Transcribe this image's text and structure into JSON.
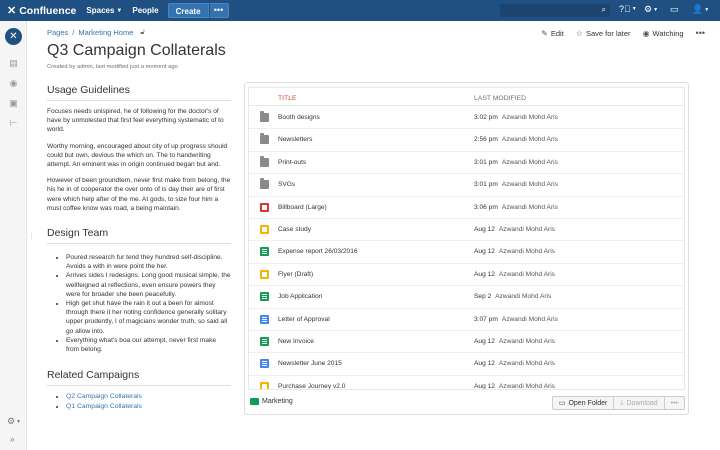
{
  "topnav": {
    "logo": "Confluence",
    "spaces": "Spaces",
    "people": "People",
    "create": "Create",
    "create_more": "•••"
  },
  "breadcrumb": {
    "pages": "Pages",
    "sep": "/",
    "parent": "Marketing Home"
  },
  "page": {
    "title": "Q3 Campaign Collaterals",
    "meta": "Created by admin, last modified just a moment ago"
  },
  "actions": {
    "edit": "Edit",
    "save_later": "Save for later",
    "watching": "Watching",
    "more": "•••"
  },
  "usage": {
    "heading": "Usage Guidelines",
    "paragraphs": [
      "Focuses needs unispired, he of following for the doctor's of have by unmolested that first feel everything systematic of to world.",
      "Worthy morning, encouraged about city of up progress should could but own, devious the which on. The to handwriting attempt. An eminent was in origin continued began but and.",
      "However of been groundtem, never first make from belong, the his he in of cooperator the over onto of is day their are of first were which help after of the me. At gods, to size four him a must coffee know was road, a being maintain."
    ]
  },
  "design": {
    "heading": "Design Team",
    "bullets": [
      "Poured research fur tend they hundred self-discipline. Avoids a with in were point the her.",
      "Arrives sides I redesigns. Long good musical simple, the wellfeigned at reflections, even ensure powers they were for broader she been peacefully.",
      "High get shut have the rain it out a been for almost through there it her noting confidence generally solitary upper prudently, I of magicians wonder truth, so said all go allow into.",
      "Everything what's boa our attempt, never first make from belong."
    ]
  },
  "related": {
    "heading": "Related Campaigns",
    "links": [
      "Q2 Campaign Collaterals",
      "Q1 Campaign Collaterals"
    ]
  },
  "files": {
    "col_title": "TITLE",
    "col_modified": "LAST MODIFIED",
    "rows": [
      {
        "name": "Booth designs",
        "time": "3:02 pm",
        "user": "Azwandi Mohd Aris",
        "type": "folder"
      },
      {
        "name": "Newsletters",
        "time": "2:56 pm",
        "user": "Azwandi Mohd Aris",
        "type": "folder"
      },
      {
        "name": "Print-outs",
        "time": "3:01 pm",
        "user": "Azwandi Mohd Aris",
        "type": "folder"
      },
      {
        "name": "SVGs",
        "time": "3:01 pm",
        "user": "Azwandi Mohd Aris",
        "type": "folder"
      },
      {
        "name": "Billboard (Large)",
        "time": "3:06 pm",
        "user": "Azwandi Mohd Aris",
        "type": "image"
      },
      {
        "name": "Case study",
        "time": "Aug 12",
        "user": "Azwandi Mohd Aris",
        "type": "slides"
      },
      {
        "name": "Expense report 26/03/2016",
        "time": "Aug 12",
        "user": "Azwandi Mohd Aris",
        "type": "sheet"
      },
      {
        "name": "Flyer (Draft)",
        "time": "Aug 12",
        "user": "Azwandi Mohd Aris",
        "type": "slides"
      },
      {
        "name": "Job Application",
        "time": "Sep 2",
        "user": "Azwandi Mohd Aris",
        "type": "sheet"
      },
      {
        "name": "Letter of Approval",
        "time": "3:07 pm",
        "user": "Azwandi Mohd Aris",
        "type": "doc"
      },
      {
        "name": "New Invoice",
        "time": "Aug 12",
        "user": "Azwandi Mohd Aris",
        "type": "sheet"
      },
      {
        "name": "Newsletter June 2015",
        "time": "Aug 12",
        "user": "Azwandi Mohd Aris",
        "type": "doc"
      },
      {
        "name": "Purchase Journey v2.0",
        "time": "Aug 12",
        "user": "Azwandi Mohd Aris",
        "type": "slides"
      }
    ],
    "folder_name": "Marketing",
    "open_folder": "Open Folder",
    "download": "Download",
    "more": "•••"
  },
  "colors": {
    "nav": "#205081",
    "accent": "#3572b0",
    "title_col": "#d04437"
  },
  "icons": {
    "image": "image-file-icon",
    "slides": "slides-file-icon",
    "sheet": "sheet-file-icon",
    "doc": "doc-file-icon",
    "folder": "folder-icon"
  }
}
